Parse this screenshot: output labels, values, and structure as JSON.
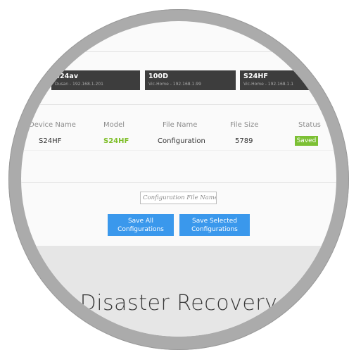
{
  "devices": [
    {
      "name": "",
      "sub": ""
    },
    {
      "name": "S24av",
      "sub": "Dusan - 192.168.1.201"
    },
    {
      "name": "100D",
      "sub": "Vic-Home - 192.168.1.99"
    },
    {
      "name": "S24HF",
      "sub": "Vic-Home - 192.168.1.1"
    }
  ],
  "table": {
    "headers": [
      "Device Name",
      "Model",
      "File Name",
      "File Size",
      "Status"
    ],
    "row": {
      "device": "S24HF",
      "model": "S24HF",
      "file": "Configuration",
      "size": "5789",
      "status": "Saved"
    }
  },
  "form": {
    "placeholder": "Configuration File Name",
    "save_all": [
      "Save All",
      "Configurations"
    ],
    "save_selected": [
      "Save Selected",
      "Configurations"
    ]
  },
  "heading": "Disaster Recovery",
  "colors": {
    "card": "#3d3d3d",
    "model": "#7fbf2a",
    "badge": "#7cc034",
    "button": "#3a98ec"
  }
}
